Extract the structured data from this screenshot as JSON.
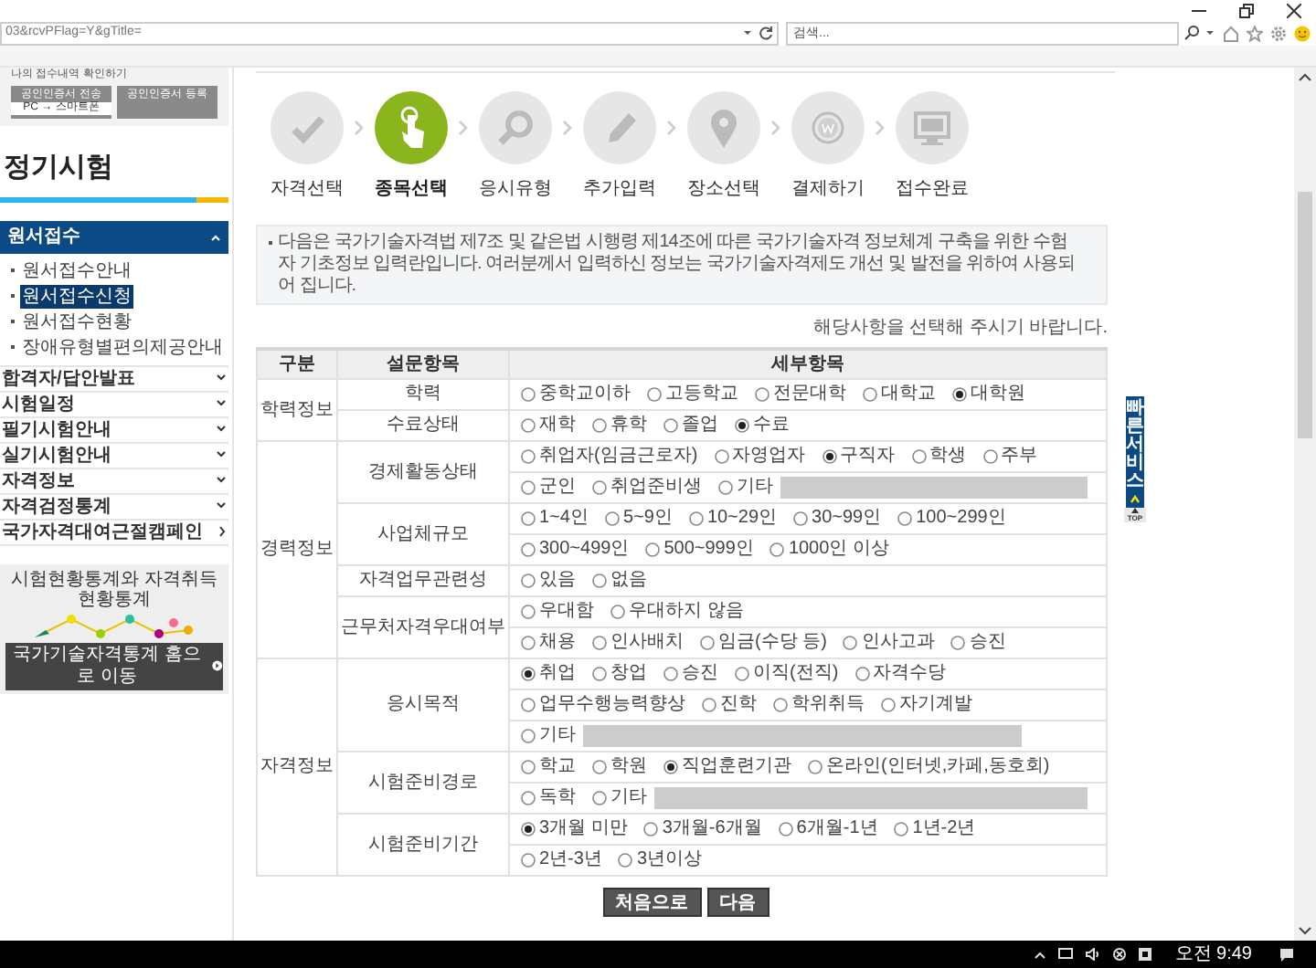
{
  "browser": {
    "address": "03&rcvPFlag=Y&gTitle=",
    "search_placeholder": "검색..."
  },
  "sidebar": {
    "note": "나의 접수내역 확인하기",
    "cert_buttons": [
      {
        "label": "공인인증서 전송",
        "sub": "PC → 스마트폰"
      },
      {
        "label": "공인인증서 등록"
      }
    ],
    "title": "정기시험",
    "menu": [
      {
        "label": "원서접수",
        "kind": "section",
        "expanded": true,
        "children": [
          {
            "label": "원서접수안내",
            "selected": false
          },
          {
            "label": "원서접수신청",
            "selected": true
          },
          {
            "label": "원서접수현황",
            "selected": false
          },
          {
            "label": "장애유형별편의제공안내",
            "selected": false
          }
        ]
      },
      {
        "label": "합격자/답안발표",
        "kind": "section",
        "expanded": false
      },
      {
        "label": "시험일정",
        "kind": "section",
        "expanded": false
      },
      {
        "label": "필기시험안내",
        "kind": "section",
        "expanded": false
      },
      {
        "label": "실기시험안내",
        "kind": "section",
        "expanded": false
      },
      {
        "label": "자격정보",
        "kind": "section",
        "expanded": false
      },
      {
        "label": "자격검정통계",
        "kind": "section",
        "expanded": false
      },
      {
        "label": "국가자격대여근절캠페인",
        "kind": "link"
      }
    ],
    "banner": {
      "title": "시험현황통계와 자격취득현황통계",
      "button": "국가기술자격통계 홈으로 이동"
    }
  },
  "steps": [
    {
      "label": "자격선택",
      "selected": false
    },
    {
      "label": "종목선택",
      "selected": true
    },
    {
      "label": "응시유형",
      "selected": false
    },
    {
      "label": "추가입력",
      "selected": false
    },
    {
      "label": "장소선택",
      "selected": false
    },
    {
      "label": "결제하기",
      "selected": false
    },
    {
      "label": "접수완료",
      "selected": false
    }
  ],
  "notice": "다음은 국가기술자격법 제7조 및 같은법 시행령 제14조에 따른 국가기술자격 정보체계 구축을 위한 수험자 기초정보 입력란입니다. 여러분께서 입력하신 정보는 국가기술자격제도 개선 및 발전을 위하여 사용되어 집니다.",
  "hint": "해당사항을 선택해 주시기 바랍니다.",
  "table": {
    "columns": [
      "구분",
      "설문항목",
      "세부항목"
    ],
    "groups": [
      {
        "category": "학력정보",
        "questions": [
          {
            "label": "학력",
            "lines": [
              [
                {
                  "label": "중학교이하",
                  "selected": false
                },
                {
                  "label": "고등학교",
                  "selected": false
                },
                {
                  "label": "전문대학",
                  "selected": false
                },
                {
                  "label": "대학교",
                  "selected": false
                },
                {
                  "label": "대학원",
                  "selected": true
                }
              ]
            ]
          },
          {
            "label": "수료상태",
            "lines": [
              [
                {
                  "label": "재학",
                  "selected": false
                },
                {
                  "label": "휴학",
                  "selected": false
                },
                {
                  "label": "졸업",
                  "selected": false
                },
                {
                  "label": "수료",
                  "selected": true
                }
              ]
            ]
          }
        ]
      },
      {
        "category": "경력정보",
        "questions": [
          {
            "label": "경제활동상태",
            "lines": [
              [
                {
                  "label": "취업자(임금근로자)",
                  "selected": false
                },
                {
                  "label": "자영업자",
                  "selected": false
                },
                {
                  "label": "구직자",
                  "selected": true
                },
                {
                  "label": "학생",
                  "selected": false
                },
                {
                  "label": "주부",
                  "selected": false
                }
              ],
              [
                {
                  "label": "군인",
                  "selected": false
                },
                {
                  "label": "취업준비생",
                  "selected": false
                },
                {
                  "label": "기타",
                  "selected": false,
                  "kind": "with_field"
                }
              ]
            ]
          },
          {
            "label": "사업체규모",
            "lines": [
              [
                {
                  "label": "1~4인",
                  "selected": false
                },
                {
                  "label": "5~9인",
                  "selected": false
                },
                {
                  "label": "10~29인",
                  "selected": false
                },
                {
                  "label": "30~99인",
                  "selected": false
                },
                {
                  "label": "100~299인",
                  "selected": false
                }
              ],
              [
                {
                  "label": "300~499인",
                  "selected": false
                },
                {
                  "label": "500~999인",
                  "selected": false
                },
                {
                  "label": "1000인 이상",
                  "selected": false
                }
              ]
            ]
          },
          {
            "label": "자격업무관련성",
            "lines": [
              [
                {
                  "label": "있음",
                  "selected": false
                },
                {
                  "label": "없음",
                  "selected": false
                }
              ]
            ]
          },
          {
            "label": "근무처자격우대여부",
            "lines": [
              [
                {
                  "label": "우대함",
                  "selected": false
                },
                {
                  "label": "우대하지 않음",
                  "selected": false
                }
              ],
              [
                {
                  "label": "채용",
                  "selected": false
                },
                {
                  "label": "인사배치",
                  "selected": false
                },
                {
                  "label": "임금(수당 등)",
                  "selected": false
                },
                {
                  "label": "인사고과",
                  "selected": false
                },
                {
                  "label": "승진",
                  "selected": false
                }
              ]
            ]
          }
        ]
      },
      {
        "category": "자격정보",
        "questions": [
          {
            "label": "응시목적",
            "lines": [
              [
                {
                  "label": "취업",
                  "selected": true
                },
                {
                  "label": "창업",
                  "selected": false
                },
                {
                  "label": "승진",
                  "selected": false
                },
                {
                  "label": "이직(전직)",
                  "selected": false
                },
                {
                  "label": "자격수당",
                  "selected": false
                }
              ],
              [
                {
                  "label": "업무수행능력향상",
                  "selected": false
                },
                {
                  "label": "진학",
                  "selected": false
                },
                {
                  "label": "학위취득",
                  "selected": false
                },
                {
                  "label": "자기계발",
                  "selected": false
                }
              ],
              [
                {
                  "label": "기타",
                  "selected": false,
                  "kind": "with_field"
                }
              ]
            ]
          },
          {
            "label": "시험준비경로",
            "lines": [
              [
                {
                  "label": "학교",
                  "selected": false
                },
                {
                  "label": "학원",
                  "selected": false
                },
                {
                  "label": "직업훈련기관",
                  "selected": true
                },
                {
                  "label": "온라인(인터넷,카페,동호회)",
                  "selected": false
                }
              ],
              [
                {
                  "label": "독학",
                  "selected": false
                },
                {
                  "label": "기타",
                  "selected": false,
                  "kind": "with_field"
                }
              ]
            ]
          },
          {
            "label": "시험준비기간",
            "lines": [
              [
                {
                  "label": "3개월 미만",
                  "selected": true
                },
                {
                  "label": "3개월-6개월",
                  "selected": false
                },
                {
                  "label": "6개월-1년",
                  "selected": false
                },
                {
                  "label": "1년-2년",
                  "selected": false
                }
              ],
              [
                {
                  "label": "2년-3년",
                  "selected": false
                },
                {
                  "label": "3년이상",
                  "selected": false
                }
              ]
            ]
          }
        ]
      }
    ]
  },
  "buttons": [
    "처음으로",
    "다음"
  ],
  "quick_bar": {
    "label": "빠른서비스",
    "top": "TOP"
  },
  "taskbar": {
    "time": "오전 9:49"
  }
}
